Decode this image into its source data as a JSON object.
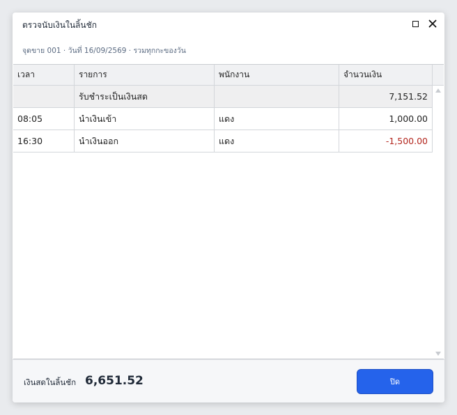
{
  "window": {
    "title": "ตรวจนับเงินในลิ้นชัก",
    "subtitle": "จุดขาย 001 · วันที่ 16/09/2569 · รวมทุกกะของวัน"
  },
  "table": {
    "columns": [
      "เวลา",
      "รายการ",
      "พนักงาน",
      "จำนวนเงิน"
    ],
    "summary_row": {
      "time": "",
      "item": "รับชำระเป็นเงินสด",
      "staff": "",
      "amount": "7,151.52"
    },
    "rows": [
      {
        "time": "08:05",
        "item": "นำเงินเข้า",
        "staff": "แดง",
        "amount": "1,000.00"
      },
      {
        "time": "16:30",
        "item": "นำเงินออก",
        "staff": "แดง",
        "amount": "-1,500.00"
      }
    ]
  },
  "footer": {
    "cash_label": "เงินสดในลิ้นชัก",
    "cash_value": "6,651.52",
    "close_label": "ปิด"
  },
  "colors": {
    "primary_button": "#2563eb",
    "negative_amount": "#b3261e"
  }
}
